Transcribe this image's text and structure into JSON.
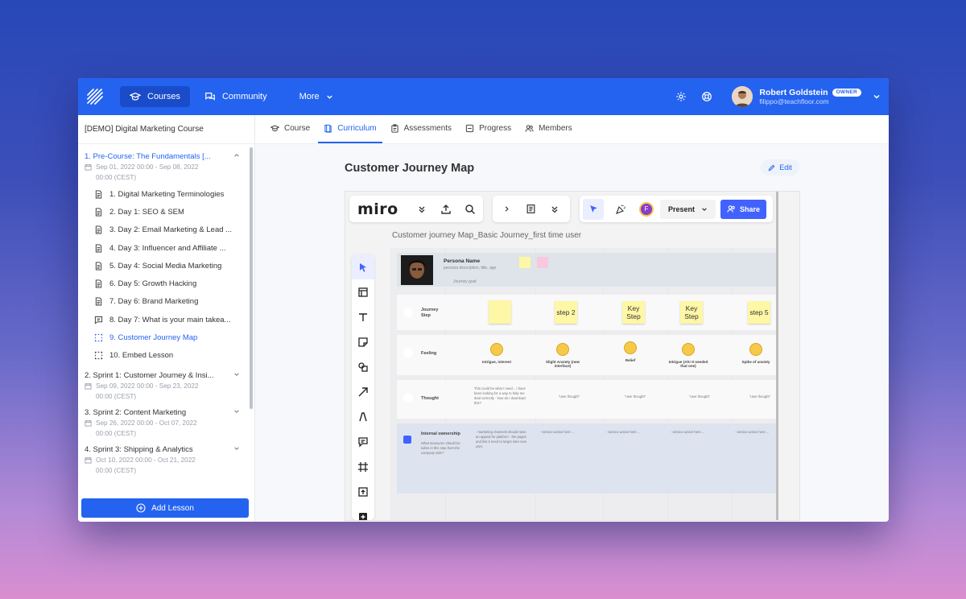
{
  "topbar": {
    "nav": [
      {
        "label": "Courses",
        "icon": "graduation-cap-icon",
        "active": true
      },
      {
        "label": "Community",
        "icon": "chat-bubbles-icon",
        "active": false
      },
      {
        "label": "More",
        "icon": "chevron-down-icon",
        "active": false
      }
    ],
    "user": {
      "name": "Robert Goldstein",
      "role": "OWNER",
      "email": "filippo@teachfloor.com"
    }
  },
  "sidebar": {
    "course_title": "[DEMO] Digital Marketing Course",
    "sections": [
      {
        "title": "1. Pre-Course: The Fundamentals [...",
        "date_line1": "Sep 01, 2022 00:00 - Sep 08, 2022",
        "date_line2": "00:00 (CEST)",
        "expanded": true,
        "lessons": [
          {
            "label": "1. Digital Marketing Terminologies",
            "icon": "document-icon"
          },
          {
            "label": "2. Day 1: SEO & SEM",
            "icon": "document-icon"
          },
          {
            "label": "3. Day 2: Email Marketing & Lead ...",
            "icon": "document-icon"
          },
          {
            "label": "4. Day 3: Influencer and Affiliate ...",
            "icon": "document-icon"
          },
          {
            "label": "5. Day 4: Social Media Marketing",
            "icon": "document-icon"
          },
          {
            "label": "6. Day 5: Growth Hacking",
            "icon": "document-icon"
          },
          {
            "label": "7. Day 6: Brand Marketing",
            "icon": "document-icon"
          },
          {
            "label": "8. Day 7: What is your main takea...",
            "icon": "comment-icon"
          },
          {
            "label": "9. Customer Journey Map",
            "icon": "embed-icon",
            "active": true
          },
          {
            "label": "10. Embed Lesson",
            "icon": "embed-icon"
          }
        ]
      },
      {
        "title": "2. Sprint 1: Customer Journey & Insi...",
        "date_line1": "Sep 09, 2022 00:00 - Sep 23, 2022",
        "date_line2": "00:00 (CEST)"
      },
      {
        "title": "3. Sprint 2: Content Marketing",
        "date_line1": "Sep 26, 2022 00:00 - Oct 07, 2022",
        "date_line2": "00:00 (CEST)"
      },
      {
        "title": "4. Sprint 3: Shipping & Analytics",
        "date_line1": "Oct 10, 2022 00:00 - Oct 21, 2022",
        "date_line2": "00:00 (CEST)"
      }
    ],
    "add_lesson_label": "Add Lesson"
  },
  "tabs": [
    {
      "label": "Course",
      "icon": "graduation-cap-icon"
    },
    {
      "label": "Curriculum",
      "icon": "book-icon",
      "active": true
    },
    {
      "label": "Assessments",
      "icon": "clipboard-icon"
    },
    {
      "label": "Progress",
      "icon": "progress-icon"
    },
    {
      "label": "Members",
      "icon": "users-icon"
    }
  ],
  "lesson": {
    "title": "Customer Journey Map",
    "edit_label": "Edit"
  },
  "miro": {
    "logo": "miro",
    "present_label": "Present",
    "share_label": "Share",
    "avatar_initial": "F",
    "board_title": "Customer journey Map_Basic Journey_first time user",
    "persona": {
      "name": "Persona Name",
      "desc": "persona description, title, age",
      "goal": "Journey goal"
    },
    "rows": {
      "journey": "Journey Step",
      "feeling": "Feeling",
      "thought": "Thought",
      "ownership": "Internal ownership"
    },
    "ownership_desc": "What measures should be taken in this step from the company side?",
    "steps": [
      "step 2",
      "Key Step",
      "Key Step",
      "step 5"
    ],
    "feelings": [
      "Intrigue, interest",
      "Slight Anxiety (new interface)",
      "Relief",
      "Intrigue (Ah! It needed that one)",
      "Spike of anxiety"
    ],
    "thought_first": "This could be what I need... I have been looking for a way to help me deal correctly - how do I download this?",
    "thought_other": "\"user thought\"",
    "ownership_notes": "- marketing channels should raise an appeal for platform - the pages and link it need to target inter new user.",
    "ownership_other": "- service action here ..."
  },
  "colors": {
    "brand": "#2463f0",
    "miro_share": "#4262ff",
    "sticky": "#fef7a5"
  }
}
